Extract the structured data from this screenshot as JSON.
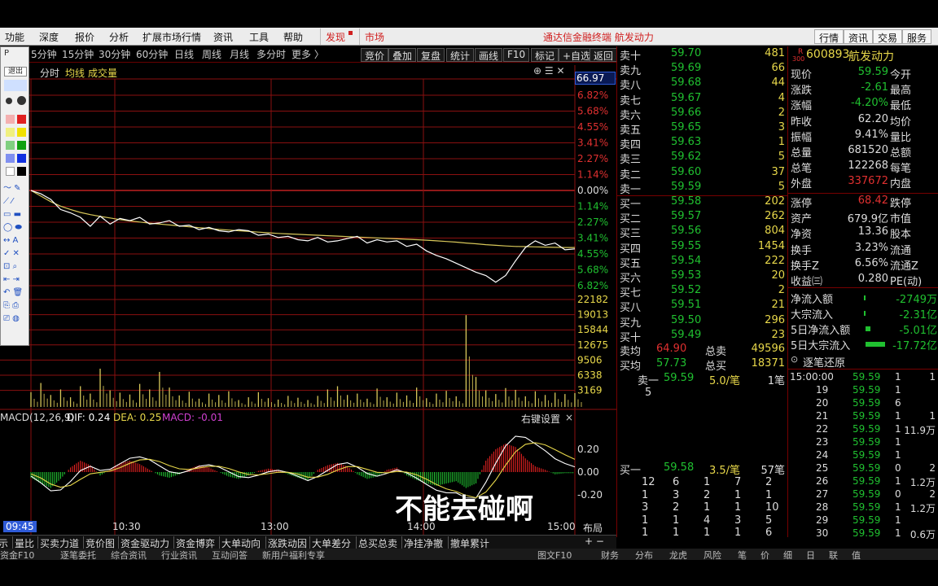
{
  "menu": {
    "items": [
      "功能",
      "深度",
      "报价",
      "分析",
      "扩展市场行情",
      "资讯",
      "工具",
      "帮助"
    ],
    "discover": "发现",
    "market": "市场",
    "title": "通达信金融终端  航发动力",
    "right_buttons": [
      "行情",
      "资讯",
      "交易",
      "服务"
    ]
  },
  "toolbar": {
    "periods": [
      "5分钟",
      "15分钟",
      "30分钟",
      "60分钟",
      "日线",
      "周线",
      "月线",
      "多分时",
      "更多 〉"
    ],
    "buttons": [
      "竞价",
      "叠加",
      "复盘",
      "统计",
      "画线",
      "F10",
      "标记",
      "+自选",
      "返回"
    ]
  },
  "drawbar": {
    "exit_label": "退出"
  },
  "chart_header": {
    "items": [
      "分时",
      "均线",
      "成交量"
    ],
    "top_price": "66.97"
  },
  "chart_data": [
    {
      "type": "line",
      "title": "分时",
      "y_labels_right": [
        "6.82%",
        "5.68%",
        "4.55%",
        "3.41%",
        "2.27%",
        "1.14%",
        "0.00%",
        "1.14%",
        "2.27%",
        "3.41%",
        "4.55%",
        "5.68%",
        "6.82%"
      ],
      "x_labels": [
        "09:45",
        "10:30",
        "13:00",
        "14:00",
        "15:00"
      ],
      "series": [
        {
          "name": "price",
          "values": [
            62.2,
            62.05,
            61.8,
            61.35,
            61.2,
            61.0,
            60.6,
            61.05,
            60.7,
            60.95,
            60.85,
            61.0,
            60.7,
            60.75,
            60.85,
            60.6,
            60.65,
            60.45,
            60.55,
            60.4,
            60.35,
            60.45,
            60.4,
            60.2,
            60.25,
            60.1,
            60.15,
            60.0,
            59.95,
            60.1,
            59.9,
            59.95,
            60.05,
            60.15,
            59.85,
            60.0,
            59.9,
            59.95,
            59.7,
            59.8,
            59.5,
            59.3,
            59.15,
            58.95,
            58.75,
            58.55,
            58.4,
            58.1,
            58.4,
            59.05,
            59.65,
            59.95,
            59.75,
            59.85,
            59.55,
            59.59
          ]
        },
        {
          "name": "avg",
          "values": [
            62.2,
            61.95,
            61.7,
            61.5,
            61.35,
            61.22,
            61.12,
            61.04,
            60.97,
            60.9,
            60.84,
            60.79,
            60.74,
            60.7,
            60.66,
            60.62,
            60.58,
            60.54,
            60.5,
            60.46,
            60.43,
            60.4,
            60.37,
            60.34,
            60.31,
            60.28,
            60.26,
            60.24,
            60.22,
            60.2,
            60.18,
            60.16,
            60.14,
            60.12,
            60.1,
            60.08,
            60.06,
            60.04,
            60.02,
            60.0,
            59.98,
            59.95,
            59.92,
            59.89,
            59.85,
            59.82,
            59.78,
            59.75,
            59.72,
            59.7,
            59.69,
            59.68,
            59.67,
            59.66,
            59.65,
            59.65
          ]
        }
      ]
    },
    {
      "type": "bar",
      "title": "成交量",
      "y_labels_right": [
        "22182",
        "19013",
        "15844",
        "12675",
        "9506",
        "6338",
        "3169"
      ],
      "values": [
        3200,
        5200,
        2600,
        3800,
        2100,
        4500,
        2900,
        8300,
        3600,
        3100,
        2700,
        5000,
        3800,
        7600,
        4200,
        2500,
        3300,
        1800,
        2900,
        2600,
        3400,
        1500,
        2100,
        3200,
        1900,
        1600,
        2400,
        2000,
        1500,
        2400,
        3800,
        4500,
        2600,
        2900,
        1800,
        4000,
        2100,
        3100,
        2500,
        4200,
        1900,
        2900,
        3500,
        2300,
        19900,
        6500,
        3600,
        2800,
        4100,
        3700,
        2300,
        3400,
        2600,
        3100,
        2800,
        3000
      ]
    },
    {
      "type": "bar",
      "title": "MACD(12,26,9)",
      "labels": {
        "dif": "DIF: 0.24",
        "dea": "DEA: 0.25",
        "macd": "MACD: -0.01",
        "settings": "右键设置"
      },
      "y_labels_right": [
        "0.20",
        "0.00",
        "-0.20"
      ],
      "values": [
        -0.05,
        -0.1,
        -0.14,
        -0.06,
        0.04,
        0.1,
        0.06,
        -0.03,
        0.02,
        0.08,
        0.1,
        0.07,
        0.02,
        -0.03,
        -0.05,
        -0.02,
        0.03,
        0.06,
        0.04,
        0.0,
        -0.04,
        -0.06,
        -0.03,
        0.01,
        0.03,
        0.02,
        -0.02,
        -0.05,
        -0.07,
        0.02,
        0.06,
        0.08,
        0.05,
        -0.02,
        -0.06,
        -0.04,
        0.02,
        0.04,
        -0.03,
        -0.07,
        -0.1,
        -0.12,
        -0.1,
        -0.08,
        -0.14,
        -0.1,
        0.1,
        0.2,
        0.25,
        0.22,
        0.12,
        0.05,
        0.02,
        -0.02,
        -0.01,
        -0.01
      ]
    }
  ],
  "orderbook": {
    "asks": [
      {
        "label": "卖十",
        "price": "59.70",
        "vol": "481"
      },
      {
        "label": "卖九",
        "price": "59.69",
        "vol": "66"
      },
      {
        "label": "卖八",
        "price": "59.68",
        "vol": "44"
      },
      {
        "label": "卖七",
        "price": "59.67",
        "vol": "4"
      },
      {
        "label": "卖六",
        "price": "59.66",
        "vol": "2"
      },
      {
        "label": "卖五",
        "price": "59.65",
        "vol": "3"
      },
      {
        "label": "卖四",
        "price": "59.63",
        "vol": "1"
      },
      {
        "label": "卖三",
        "price": "59.62",
        "vol": "5"
      },
      {
        "label": "卖二",
        "price": "59.60",
        "vol": "37"
      },
      {
        "label": "卖一",
        "price": "59.59",
        "vol": "5"
      }
    ],
    "bids": [
      {
        "label": "买一",
        "price": "59.58",
        "vol": "202"
      },
      {
        "label": "买二",
        "price": "59.57",
        "vol": "262"
      },
      {
        "label": "买三",
        "price": "59.56",
        "vol": "804"
      },
      {
        "label": "买四",
        "price": "59.55",
        "vol": "1454"
      },
      {
        "label": "买五",
        "price": "59.54",
        "vol": "222"
      },
      {
        "label": "买六",
        "price": "59.53",
        "vol": "20"
      },
      {
        "label": "买七",
        "price": "59.52",
        "vol": "2"
      },
      {
        "label": "买八",
        "price": "59.51",
        "vol": "21"
      },
      {
        "label": "买九",
        "price": "59.50",
        "vol": "296"
      },
      {
        "label": "买十",
        "price": "59.49",
        "vol": "23"
      }
    ],
    "sell_avg_label": "卖均",
    "sell_avg": "64.90",
    "sell_total_label": "总卖",
    "sell_total": "49596",
    "buy_avg_label": "买均",
    "buy_avg": "57.73",
    "buy_total_label": "总买",
    "buy_total": "18371",
    "queue_sell": {
      "label": "卖一",
      "price": "59.59",
      "per": "5.0/笔",
      "count": "1笔",
      "items": [
        "5"
      ]
    },
    "queue_buy": {
      "label": "买一",
      "price": "59.58",
      "per": "3.5/笔",
      "count": "57笔",
      "rows": [
        [
          "12",
          "6",
          "1",
          "7",
          "2"
        ],
        [
          "1",
          "3",
          "2",
          "1",
          "1"
        ],
        [
          "3",
          "2",
          "1",
          "1",
          "10"
        ],
        [
          "1",
          "1",
          "4",
          "3",
          "5"
        ],
        [
          "1",
          "1",
          "1",
          "1",
          "6"
        ]
      ]
    }
  },
  "info": {
    "badge": "R",
    "badge_sub": "300",
    "code": "600893",
    "name": "航发动力",
    "rows": [
      {
        "l": "现价",
        "v": "59.59",
        "r": "今开"
      },
      {
        "l": "涨跌",
        "v": "-2.61",
        "r": "最高"
      },
      {
        "l": "涨幅",
        "v": "-4.20%",
        "r": "最低"
      },
      {
        "l": "昨收",
        "v": "62.20",
        "r": "均价"
      },
      {
        "l": "振幅",
        "v": "9.41%",
        "r": "量比"
      },
      {
        "l": "总量",
        "v": "681520",
        "r": "总额"
      },
      {
        "l": "总笔",
        "v": "122268",
        "r": "每笔"
      },
      {
        "l": "外盘",
        "v": "337672",
        "r": "内盘"
      },
      {
        "l": "涨停",
        "v": "68.42",
        "r": "跌停"
      },
      {
        "l": "资产",
        "v": "679.9亿",
        "r": "市值"
      },
      {
        "l": "净资",
        "v": "13.36",
        "r": "股本"
      },
      {
        "l": "换手",
        "v": "3.23%",
        "r": "流通"
      },
      {
        "l": "换手Z",
        "v": "6.56%",
        "r": "流通Z"
      },
      {
        "l": "收益㈢",
        "v": "0.280",
        "r": "PE(动)"
      }
    ],
    "flows": [
      {
        "l": "净流入额",
        "v": "-2749万"
      },
      {
        "l": "大宗流入",
        "v": "-2.31亿"
      },
      {
        "l": "5日净流入额",
        "v": "-5.01亿"
      },
      {
        "l": "5日大宗流入",
        "v": "-17.72亿"
      }
    ],
    "ticks_title": "逐笔还原",
    "ticks": [
      [
        "15:00:00",
        "59.59",
        "1",
        "1"
      ],
      [
        "19",
        "59.59",
        "1",
        ""
      ],
      [
        "20",
        "59.59",
        "6",
        ""
      ],
      [
        "21",
        "59.59",
        "1",
        "1"
      ],
      [
        "22",
        "59.59",
        "1",
        "11.9万"
      ],
      [
        "23",
        "59.59",
        "1",
        ""
      ],
      [
        "24",
        "59.59",
        "1",
        ""
      ],
      [
        "25",
        "59.59",
        "0",
        "2"
      ],
      [
        "26",
        "59.59",
        "1",
        "1.2万"
      ],
      [
        "27",
        "59.59",
        "0",
        "2"
      ],
      [
        "28",
        "59.59",
        "1",
        "1.2万"
      ],
      [
        "29",
        "59.59",
        "1",
        ""
      ],
      [
        "30",
        "59.59",
        "1",
        "0.6万"
      ]
    ]
  },
  "tabs": [
    "量比",
    "买卖力道",
    "竞价图",
    "资金驱动力",
    "资金博弈",
    "大单动向",
    "涨跌动因",
    "大单差分",
    "总买总卖",
    "净挂净撤",
    "撤单累计"
  ],
  "layout_tab": "布局",
  "bottom_row": [
    "资金F10",
    "逐笔委托",
    "综合资讯",
    "行业资讯",
    "互动问答",
    "新用户福利专享"
  ],
  "bottom_right": [
    "图文F10",
    "财务",
    "分布",
    "龙虎",
    "风险",
    "笔",
    "价",
    "细",
    "日",
    "联",
    "值"
  ],
  "subtitle": "不能去碰啊"
}
